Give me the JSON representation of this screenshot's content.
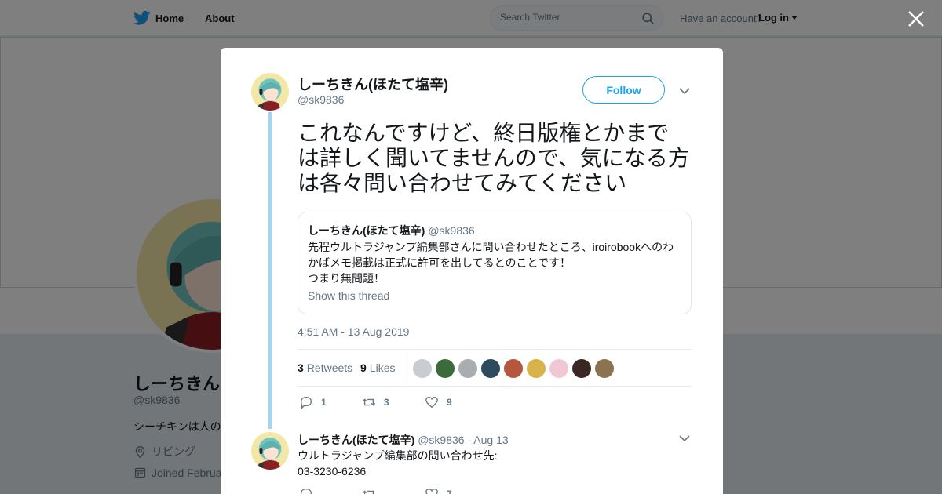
{
  "nav": {
    "home_label": "Home",
    "about_label": "About",
    "search_placeholder": "Search Twitter",
    "have_account": "Have an account?",
    "login_label": "Log in"
  },
  "profile": {
    "name": "しーちきん(",
    "handle": "@sk9836",
    "bio": "シーチキンは人の",
    "location": "リビング",
    "joined": "Joined Februa"
  },
  "tweet": {
    "author_name": "しーちきん(ほたて塩辛)",
    "author_handle": "@sk9836",
    "follow_label": "Follow",
    "text": "これなんですけど、終日版権とかまでは詳しく聞いてませんので、気になる方は各々問い合わせてみてください",
    "quote": {
      "name": "しーちきん(ほたて塩辛)",
      "handle": "@sk9836",
      "lines": [
        "先程ウルトラジャンプ編集部さんに問い合わせたところ、iroirobookへのわ",
        "かばメモ掲載は正式に許可を出してるとのことです！",
        "つまり無問題！"
      ],
      "show_thread": "Show this thread"
    },
    "timestamp": "4:51 AM - 13 Aug 2019",
    "retweets_count": "3",
    "retweets_label": "Retweets",
    "likes_count": "9",
    "likes_label": "Likes",
    "likers_colors": [
      "#c9ccd1",
      "#3b6b3a",
      "#a8aeb0",
      "#2e4a5e",
      "#b5563f",
      "#d8b24a",
      "#f2c7d4",
      "#3a2622",
      "#8c7350"
    ],
    "reply_count": "1",
    "retweet_count": "3",
    "like_count": "9"
  },
  "reply": {
    "author_name": "しーちきん(ほたて塩辛)",
    "author_handle": "@sk9836",
    "separator": "·",
    "date": "Aug 13",
    "lines": [
      "ウルトラジャンプ編集部の問い合わせ先:",
      "03-3230-6236"
    ],
    "like_count": "7"
  },
  "colors": {
    "accent": "#1da1f2",
    "thread_line": "#a3d5ee",
    "muted": "#657786"
  }
}
